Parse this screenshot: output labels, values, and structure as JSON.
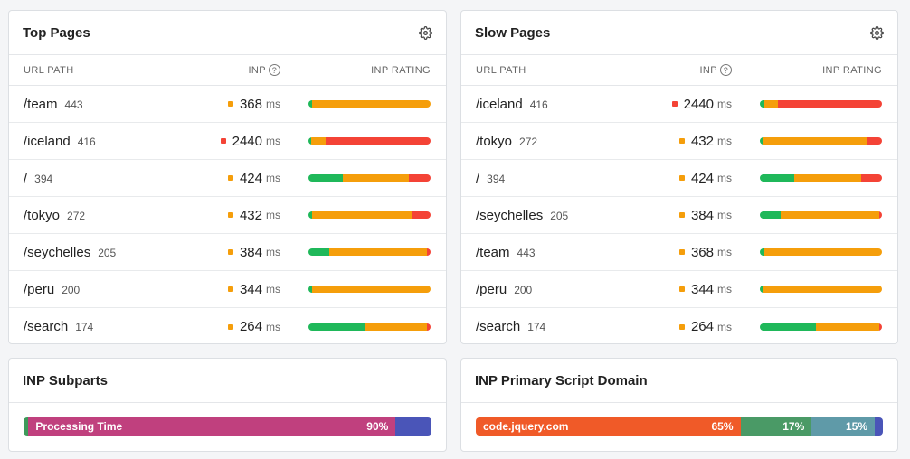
{
  "colors": {
    "good": "#1fb85a",
    "needs": "#f59e0b",
    "poor": "#f44336"
  },
  "columns": {
    "path": "URL PATH",
    "inp": "INP",
    "rating": "INP RATING",
    "info": "?"
  },
  "unit": "ms",
  "top_pages": {
    "title": "Top Pages",
    "rows": [
      {
        "path": "/team",
        "count": "443",
        "inp": "368",
        "status": "needs",
        "good": 0.03,
        "needs": 0.97,
        "poor": 0.0
      },
      {
        "path": "/iceland",
        "count": "416",
        "inp": "2440",
        "status": "poor",
        "good": 0.02,
        "needs": 0.12,
        "poor": 0.86
      },
      {
        "path": "/",
        "count": "394",
        "inp": "424",
        "status": "needs",
        "good": 0.28,
        "needs": 0.54,
        "poor": 0.18
      },
      {
        "path": "/tokyo",
        "count": "272",
        "inp": "432",
        "status": "needs",
        "good": 0.03,
        "needs": 0.82,
        "poor": 0.15
      },
      {
        "path": "/seychelles",
        "count": "205",
        "inp": "384",
        "status": "needs",
        "good": 0.17,
        "needs": 0.8,
        "poor": 0.03
      },
      {
        "path": "/peru",
        "count": "200",
        "inp": "344",
        "status": "needs",
        "good": 0.03,
        "needs": 0.97,
        "poor": 0.0
      },
      {
        "path": "/search",
        "count": "174",
        "inp": "264",
        "status": "needs",
        "good": 0.47,
        "needs": 0.5,
        "poor": 0.03
      }
    ]
  },
  "slow_pages": {
    "title": "Slow Pages",
    "rows": [
      {
        "path": "/iceland",
        "count": "416",
        "inp": "2440",
        "status": "poor",
        "good": 0.04,
        "needs": 0.11,
        "poor": 0.85
      },
      {
        "path": "/tokyo",
        "count": "272",
        "inp": "432",
        "status": "needs",
        "good": 0.03,
        "needs": 0.85,
        "poor": 0.12
      },
      {
        "path": "/",
        "count": "394",
        "inp": "424",
        "status": "needs",
        "good": 0.28,
        "needs": 0.55,
        "poor": 0.17
      },
      {
        "path": "/seychelles",
        "count": "205",
        "inp": "384",
        "status": "needs",
        "good": 0.17,
        "needs": 0.81,
        "poor": 0.02
      },
      {
        "path": "/team",
        "count": "443",
        "inp": "368",
        "status": "needs",
        "good": 0.04,
        "needs": 0.96,
        "poor": 0.0
      },
      {
        "path": "/peru",
        "count": "200",
        "inp": "344",
        "status": "needs",
        "good": 0.03,
        "needs": 0.97,
        "poor": 0.0
      },
      {
        "path": "/search",
        "count": "174",
        "inp": "264",
        "status": "needs",
        "good": 0.46,
        "needs": 0.52,
        "poor": 0.02
      }
    ]
  },
  "subparts": {
    "title": "INP Subparts",
    "segments": [
      {
        "label": "",
        "value": "",
        "fraction": 0.012,
        "color": "#3d9a5a"
      },
      {
        "label": "Processing Time",
        "value": "90%",
        "fraction": 0.9,
        "color": "#c0407e"
      },
      {
        "label": "",
        "value": "",
        "fraction": 0.088,
        "color": "#4a55b8"
      }
    ]
  },
  "script_domain": {
    "title": "INP Primary Script Domain",
    "segments": [
      {
        "label": "code.jquery.com",
        "value": "65%",
        "fraction": 0.65,
        "color": "#f05a28"
      },
      {
        "label": "",
        "value": "17%",
        "fraction": 0.175,
        "color": "#4a9a66"
      },
      {
        "label": "",
        "value": "15%",
        "fraction": 0.155,
        "color": "#5f9aa8"
      },
      {
        "label": "",
        "value": "",
        "fraction": 0.02,
        "color": "#4a55b8"
      }
    ]
  }
}
